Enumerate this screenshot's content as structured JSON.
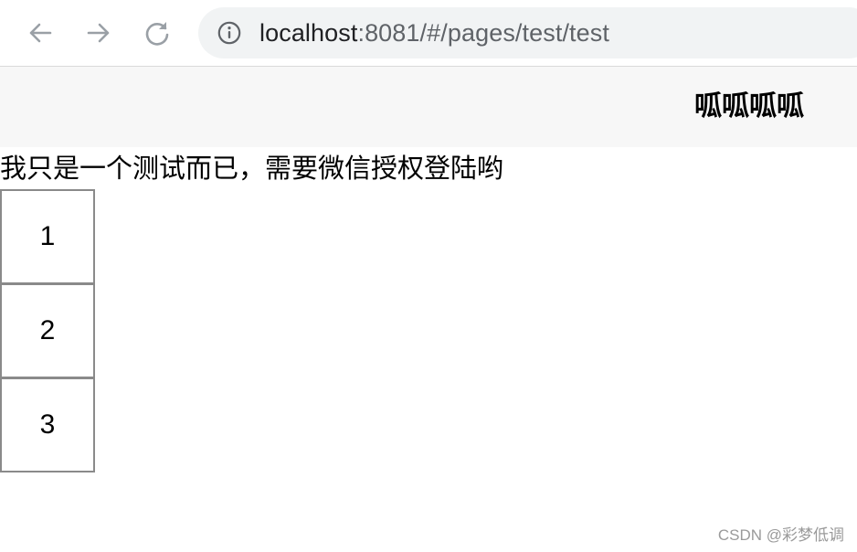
{
  "browser": {
    "url_host": "localhost",
    "url_path": ":8081/#/pages/test/test",
    "icons": {
      "back": "arrow-left-icon",
      "forward": "arrow-right-icon",
      "reload": "reload-icon",
      "info": "info-icon"
    }
  },
  "header": {
    "title": "呱呱呱呱"
  },
  "content": {
    "message": "我只是一个测试而已，需要微信授权登陆哟",
    "boxes": [
      "1",
      "2",
      "3"
    ]
  },
  "watermark": "CSDN @彩梦低调"
}
